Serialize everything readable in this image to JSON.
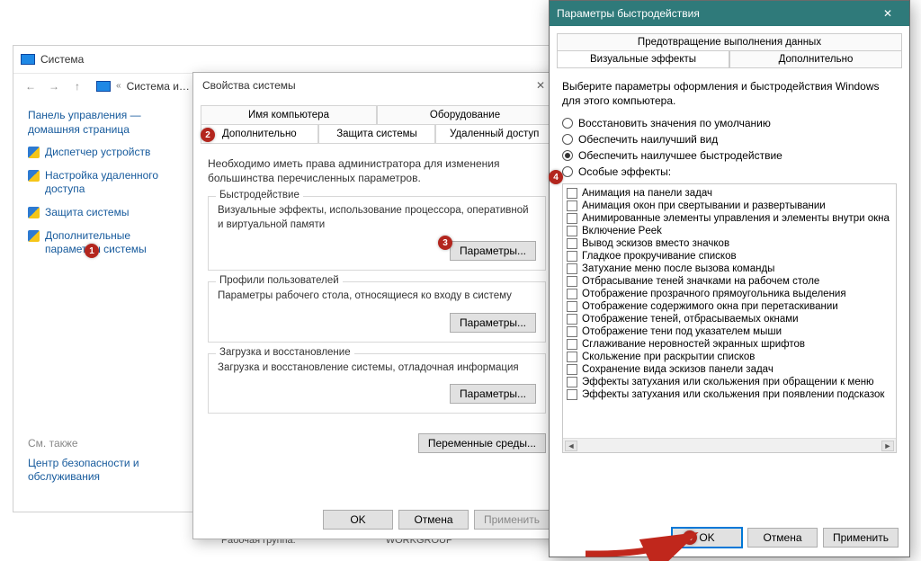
{
  "system": {
    "window_title": "Система",
    "nav": {
      "back": "←",
      "forward": "→",
      "up": "↑",
      "crumb_prefix": "«",
      "crumb": "Система и…"
    },
    "sidebar": {
      "heading": "Панель управления — домашняя страница",
      "links": [
        "Диспетчер устройств",
        "Настройка удаленного доступа",
        "Защита системы",
        "Дополнительные параметры системы"
      ],
      "see_also_label": "См. также",
      "security_link": "Центр безопасности и обслуживания"
    },
    "workgroup_label": "Рабочая группа:",
    "workgroup_value": "WORKGROUP"
  },
  "props": {
    "title": "Свойства системы",
    "tabs_top": [
      "Имя компьютера",
      "Оборудование"
    ],
    "tabs_bottom": [
      "Дополнительно",
      "Защита системы",
      "Удаленный доступ"
    ],
    "note": "Необходимо иметь права администратора для изменения большинства перечисленных параметров.",
    "groups": {
      "perf": {
        "title": "Быстродействие",
        "desc": "Визуальные эффекты, использование процессора, оперативной и виртуальной памяти",
        "button": "Параметры..."
      },
      "profiles": {
        "title": "Профили пользователей",
        "desc": "Параметры рабочего стола, относящиеся ко входу в систему",
        "button": "Параметры..."
      },
      "startup": {
        "title": "Загрузка и восстановление",
        "desc": "Загрузка и восстановление системы, отладочная информация",
        "button": "Параметры..."
      }
    },
    "env_button": "Переменные среды...",
    "buttons": {
      "ok": "OK",
      "cancel": "Отмена",
      "apply": "Применить"
    }
  },
  "perf": {
    "title": "Параметры быстродействия",
    "tab_dep": "Предотвращение выполнения данных",
    "tab_vfx": "Визуальные эффекты",
    "tab_adv": "Дополнительно",
    "desc": "Выберите параметры оформления и быстродействия Windows для этого компьютера.",
    "radios": [
      "Восстановить значения по умолчанию",
      "Обеспечить наилучший вид",
      "Обеспечить наилучшее быстродействие",
      "Особые эффекты:"
    ],
    "effects": [
      "Анимация на панели задач",
      "Анимация окон при свертывании и развертывании",
      "Анимированные элементы управления и элементы внутри окна",
      "Включение Peek",
      "Вывод эскизов вместо значков",
      "Гладкое прокручивание списков",
      "Затухание меню после вызова команды",
      "Отбрасывание теней значками на рабочем столе",
      "Отображение прозрачного прямоугольника выделения",
      "Отображение содержимого окна при перетаскивании",
      "Отображение теней, отбрасываемых окнами",
      "Отображение тени под указателем мыши",
      "Сглаживание неровностей экранных шрифтов",
      "Скольжение при раскрытии списков",
      "Сохранение вида эскизов панели задач",
      "Эффекты затухания или скольжения при обращении к меню",
      "Эффекты затухания или скольжения при появлении подсказок"
    ],
    "buttons": {
      "ok": "OK",
      "cancel": "Отмена",
      "apply": "Применить"
    }
  },
  "badges": [
    "1",
    "2",
    "3",
    "4",
    "5"
  ]
}
